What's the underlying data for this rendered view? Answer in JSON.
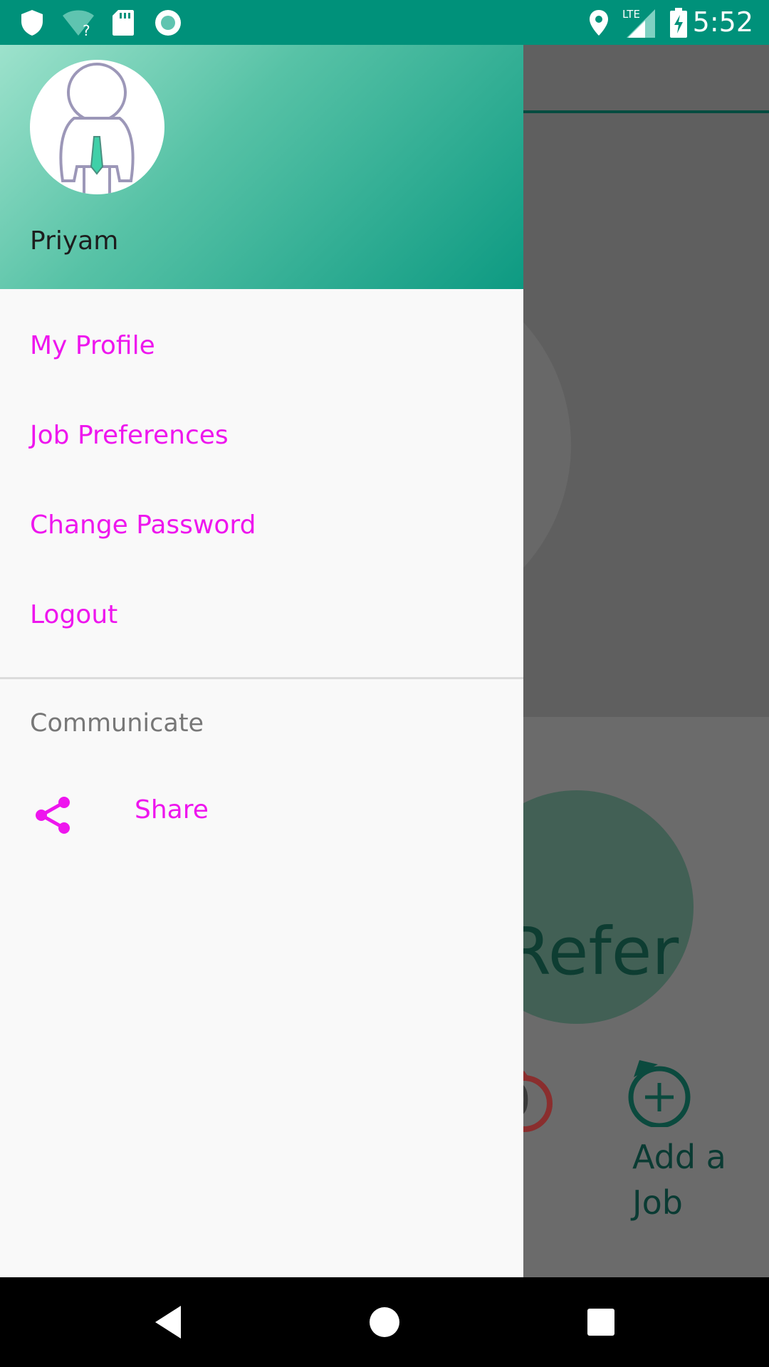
{
  "status_bar": {
    "time": "5:52",
    "network_label": "LTE",
    "icons": [
      "shield-icon",
      "wifi-unknown-icon",
      "sd-card-icon",
      "record-icon",
      "location-icon",
      "signal-icon",
      "battery-charging-icon"
    ]
  },
  "drawer": {
    "user_name": "Priyam",
    "menu": [
      {
        "label": "My Profile"
      },
      {
        "label": "Job Preferences"
      },
      {
        "label": "Change Password"
      },
      {
        "label": "Logout"
      }
    ],
    "section_label": "Communicate",
    "share": {
      "label": "Share",
      "icon": "share-icon"
    },
    "accent_color": "#EE16EE",
    "header_colors": [
      "#9DE2CC",
      "#0D9A82"
    ]
  },
  "background_screen": {
    "refer_label": "Refer",
    "red_badge_text": "0",
    "add_job_label": "Add a Job"
  },
  "nav_bar": {
    "icons": [
      "back-icon",
      "home-icon",
      "recents-icon"
    ]
  }
}
